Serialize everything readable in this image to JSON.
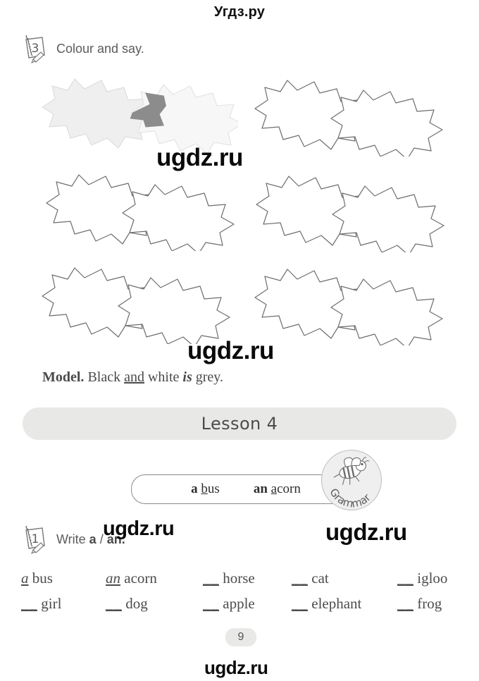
{
  "site": {
    "header_text": "Угдз.ру",
    "watermarks": [
      "ugdz.ru",
      "ugdz.ru",
      "ugdz.ru",
      "ugdz.ru",
      "ugdz.ru"
    ]
  },
  "exercise_3": {
    "number": "3",
    "instruction": "Colour and say.",
    "pairs": [
      {
        "index": 0,
        "left_fill": "#efefef",
        "overlap_fill": "#8c8c8c",
        "right_fill": "#f7f7f7",
        "coloured": true
      },
      {
        "index": 1,
        "left_fill": "#ffffff",
        "overlap_fill": "#ffffff",
        "right_fill": "#ffffff",
        "coloured": false
      },
      {
        "index": 2,
        "left_fill": "#ffffff",
        "overlap_fill": "#ffffff",
        "right_fill": "#ffffff",
        "coloured": false
      },
      {
        "index": 3,
        "left_fill": "#ffffff",
        "overlap_fill": "#ffffff",
        "right_fill": "#ffffff",
        "coloured": false
      },
      {
        "index": 4,
        "left_fill": "#ffffff",
        "overlap_fill": "#ffffff",
        "right_fill": "#ffffff",
        "coloured": false
      },
      {
        "index": 5,
        "left_fill": "#ffffff",
        "overlap_fill": "#ffffff",
        "right_fill": "#ffffff",
        "coloured": false
      }
    ],
    "model": {
      "label": "Model.",
      "word_1": "Black",
      "word_conn": "and",
      "word_2": "white",
      "verb": "is",
      "result": "grey."
    }
  },
  "lesson": {
    "title": "Lesson 4"
  },
  "grammar": {
    "badge_label": "Grammar",
    "examples": [
      {
        "article": "a",
        "first_letter": "b",
        "rest": "us"
      },
      {
        "article": "an",
        "first_letter": "a",
        "rest": "corn"
      }
    ]
  },
  "exercise_1": {
    "number": "1",
    "instruction_prefix": "Write ",
    "instruction_a": "a",
    "instruction_sep": " / ",
    "instruction_an": "an.",
    "rows": [
      [
        {
          "answer": "a",
          "blank": "",
          "word": "bus"
        },
        {
          "answer": "an",
          "blank": "",
          "word": "acorn"
        },
        {
          "answer": "",
          "blank": "__",
          "word": "horse"
        },
        {
          "answer": "",
          "blank": "__",
          "word": "cat"
        },
        {
          "answer": "",
          "blank": "__",
          "word": "igloo"
        }
      ],
      [
        {
          "answer": "",
          "blank": "__",
          "word": "girl"
        },
        {
          "answer": "",
          "blank": "__",
          "word": "dog"
        },
        {
          "answer": "",
          "blank": "__",
          "word": "apple"
        },
        {
          "answer": "",
          "blank": "__",
          "word": "elephant"
        },
        {
          "answer": "",
          "blank": "__",
          "word": "frog"
        }
      ]
    ]
  },
  "footer": {
    "page_number": "9"
  },
  "colors": {
    "ink": "#4d4d4d",
    "banner_gray": "#e8e8e6",
    "outline": "#6e6e6e"
  }
}
